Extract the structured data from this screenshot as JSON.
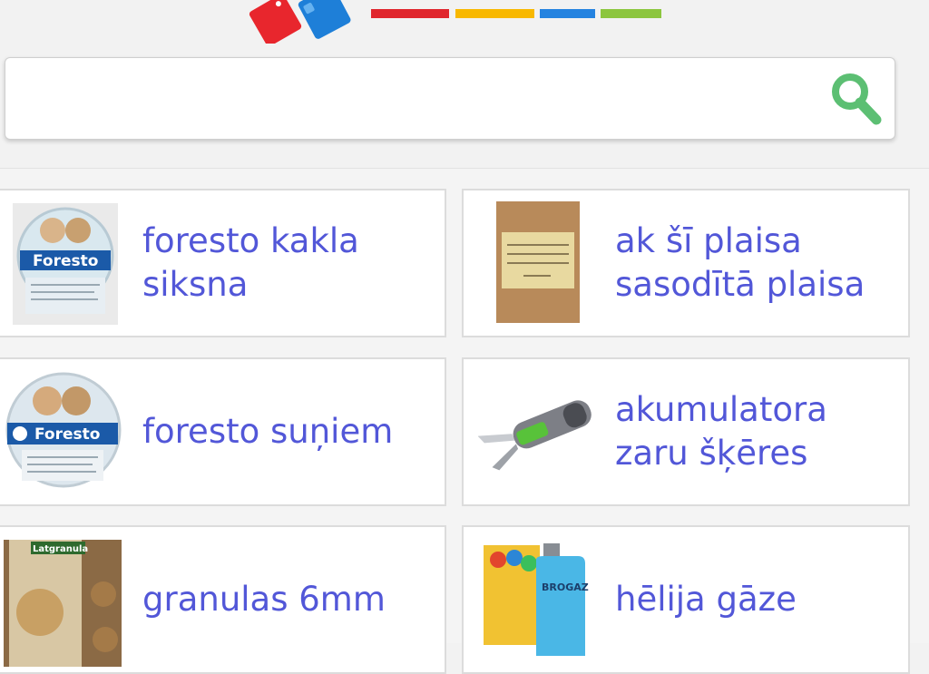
{
  "header": {
    "logo": {
      "name": "site-logo",
      "colors": [
        "#e8262d",
        "#1e7fd8"
      ]
    },
    "stripe_colors": [
      "#e0262d",
      "#f8b800",
      "#2583e0",
      "#8cc63e"
    ]
  },
  "search": {
    "value": "",
    "placeholder": "",
    "icon": "search-icon",
    "icon_color": "#5cbf73"
  },
  "products": [
    {
      "label": "foresto kakla siksna",
      "image": "foresto-collar-image"
    },
    {
      "label": "ak šī plaisa sasodītā plaisa",
      "image": "greeting-card-image"
    },
    {
      "label": "foresto suņiem",
      "image": "foresto-dog-collar-image"
    },
    {
      "label": "akumulatora zaru šķēres",
      "image": "pruning-shears-image"
    },
    {
      "label": "granulas 6mm",
      "image": "wood-pellets-image"
    },
    {
      "label": "hēlija gāze",
      "image": "helium-tank-image"
    }
  ],
  "colors": {
    "link": "#5257d8",
    "card_border": "#dcdcdc",
    "background": "#f2f2f2"
  }
}
